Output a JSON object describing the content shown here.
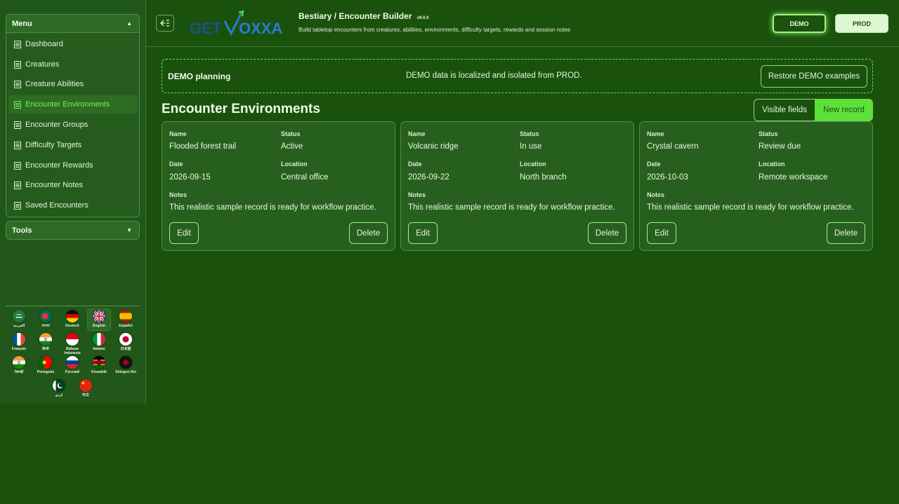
{
  "sidebar": {
    "menu_title": "Menu",
    "items": [
      {
        "label": "Dashboard",
        "active": false
      },
      {
        "label": "Creatures",
        "active": false
      },
      {
        "label": "Creature Abilities",
        "active": false
      },
      {
        "label": "Encounter Environments",
        "active": true
      },
      {
        "label": "Encounter Groups",
        "active": false
      },
      {
        "label": "Difficulty Targets",
        "active": false
      },
      {
        "label": "Encounter Rewards",
        "active": false
      },
      {
        "label": "Encounter Notes",
        "active": false
      },
      {
        "label": "Saved Encounters",
        "active": false
      }
    ],
    "tools_title": "Tools",
    "languages": [
      {
        "label": "العربية",
        "flag": "saudi"
      },
      {
        "label": "বাংলা",
        "flag": "bangladesh"
      },
      {
        "label": "Deutsch",
        "flag": "germany"
      },
      {
        "label": "English",
        "flag": "uk",
        "selected": true
      },
      {
        "label": "Español",
        "flag": "spain"
      },
      {
        "label": "Français",
        "flag": "france"
      },
      {
        "label": "हिन्दी",
        "flag": "india"
      },
      {
        "label": "Bahasa Indonesia",
        "flag": "indonesia"
      },
      {
        "label": "Italiano",
        "flag": "italy"
      },
      {
        "label": "日本語",
        "flag": "japan"
      },
      {
        "label": "ਪੰਜਾਬੀ",
        "flag": "india"
      },
      {
        "label": "Português",
        "flag": "portugal"
      },
      {
        "label": "Русский",
        "flag": "russia"
      },
      {
        "label": "Kiswahili",
        "flag": "kenya"
      },
      {
        "label": "Shingon Hol",
        "flag": "shingon"
      },
      {
        "label": "اردو",
        "flag": "pakistan"
      },
      {
        "label": "中文",
        "flag": "china"
      }
    ]
  },
  "header": {
    "logo_text": "GETVOXXA",
    "title": "Bestiary / Encounter Builder",
    "version": "v9.0.0",
    "description": "Build tabletop encounters from creatures, abilities, environments, difficulty targets, rewards and session notes",
    "demo_label": "DEMO",
    "prod_label": "PROD"
  },
  "banner": {
    "title": "DEMO planning",
    "message": "DEMO data is localized and isolated from PROD.",
    "restore_label": "Restore DEMO examples"
  },
  "page": {
    "title": "Encounter Environments",
    "visible_fields_label": "Visible fields",
    "new_record_label": "New record"
  },
  "field_labels": {
    "name": "Name",
    "status": "Status",
    "date": "Date",
    "location": "Location",
    "notes": "Notes",
    "edit": "Edit",
    "delete": "Delete"
  },
  "records": [
    {
      "name": "Flooded forest trail",
      "status": "Active",
      "date": "2026-09-15",
      "location": "Central office",
      "notes": "This realistic sample record is ready for workflow practice."
    },
    {
      "name": "Volcanic ridge",
      "status": "In use",
      "date": "2026-09-22",
      "location": "North branch",
      "notes": "This realistic sample record is ready for workflow practice."
    },
    {
      "name": "Crystal cavern",
      "status": "Review due",
      "date": "2026-10-03",
      "location": "Remote workspace",
      "notes": "This realistic sample record is ready for workflow practice."
    }
  ],
  "colors": {
    "background": "#1a520d",
    "accent": "#5ee03a",
    "active_text": "#7cf05a"
  }
}
